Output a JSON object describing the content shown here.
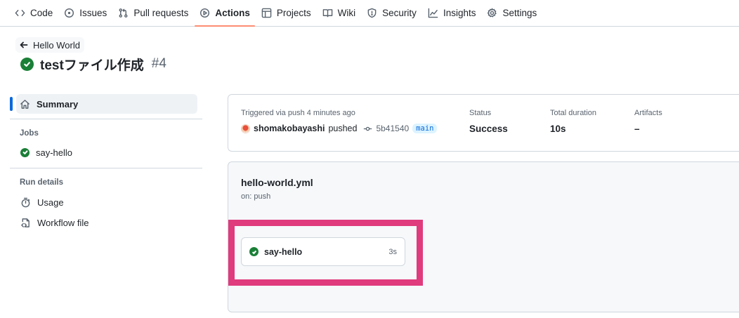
{
  "repo_nav": {
    "tabs": [
      {
        "label": "Code",
        "icon": "code-icon"
      },
      {
        "label": "Issues",
        "icon": "issue-opened-icon"
      },
      {
        "label": "Pull requests",
        "icon": "git-pull-request-icon"
      },
      {
        "label": "Actions",
        "icon": "play-icon",
        "active": true
      },
      {
        "label": "Projects",
        "icon": "table-icon"
      },
      {
        "label": "Wiki",
        "icon": "book-icon"
      },
      {
        "label": "Security",
        "icon": "shield-icon"
      },
      {
        "label": "Insights",
        "icon": "graph-icon"
      },
      {
        "label": "Settings",
        "icon": "gear-icon"
      }
    ],
    "active_underline_color": "#fd8c73"
  },
  "header": {
    "back_label": "Hello World",
    "run_title": "testファイル作成",
    "run_number": "#4",
    "status_color": "#1a7f37"
  },
  "sidebar": {
    "summary_label": "Summary",
    "jobs_heading": "Jobs",
    "jobs": [
      {
        "label": "say-hello",
        "status": "success"
      }
    ],
    "run_details_heading": "Run details",
    "run_details": [
      {
        "label": "Usage",
        "icon": "stopwatch-icon"
      },
      {
        "label": "Workflow file",
        "icon": "file-code-icon"
      }
    ],
    "accent_color": "#0969da"
  },
  "run_info": {
    "trigger_label": "Triggered via push 4 minutes ago",
    "user": "shomakobayashi",
    "verb": "pushed",
    "commit_sha": "5b41540",
    "branch": "main",
    "status_label": "Status",
    "status_value": "Success",
    "duration_label": "Total duration",
    "duration_value": "10s",
    "artifacts_label": "Artifacts",
    "artifacts_value": "–"
  },
  "workflow": {
    "file_name": "hello-world.yml",
    "trigger": "on: push",
    "jobs": [
      {
        "name": "say-hello",
        "duration": "3s",
        "status": "success"
      }
    ],
    "highlight_color": "#e03b7c"
  }
}
